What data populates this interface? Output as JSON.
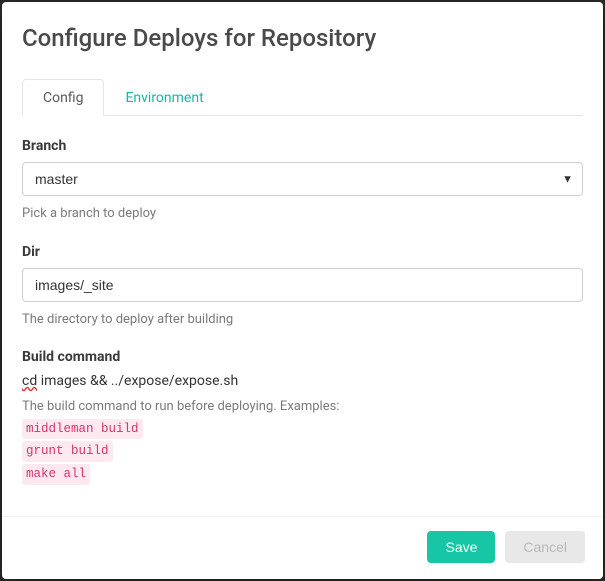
{
  "title": "Configure Deploys for Repository",
  "tabs": {
    "config": "Config",
    "environment": "Environment"
  },
  "form": {
    "branch": {
      "label": "Branch",
      "value": "master",
      "help": "Pick a branch to deploy"
    },
    "dir": {
      "label": "Dir",
      "value": "images/_site",
      "help": "The directory to deploy after building"
    },
    "build": {
      "label": "Build command",
      "value_prefix": "cd",
      "value_rest": " images && ../expose/expose.sh",
      "help_intro": "The build command to run before deploying. Examples:",
      "examples": [
        "middleman build",
        "grunt build",
        "make all"
      ]
    }
  },
  "footer": {
    "save": "Save",
    "cancel": "Cancel"
  }
}
